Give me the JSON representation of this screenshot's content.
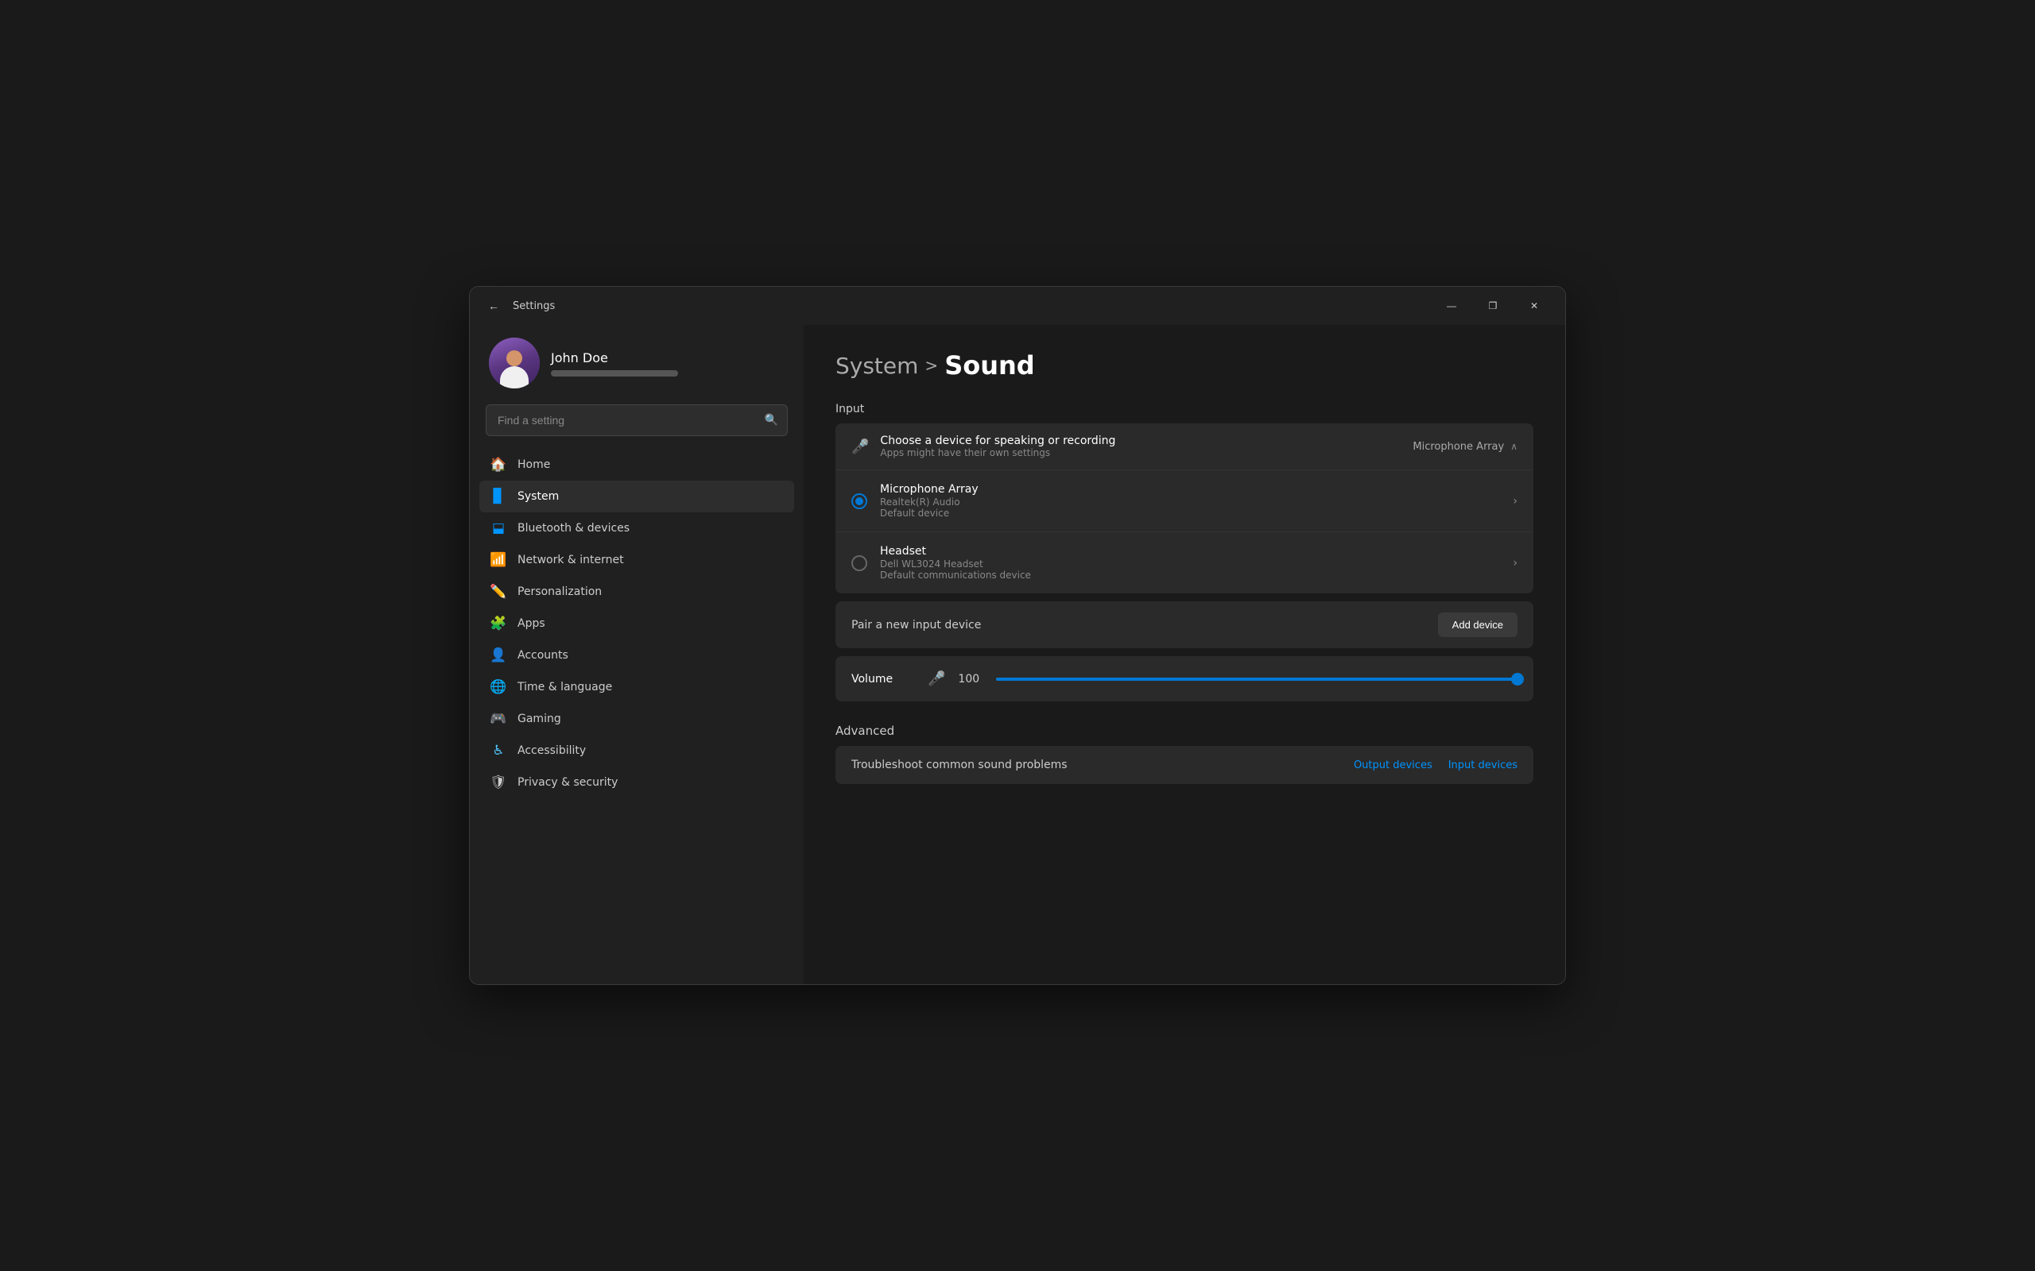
{
  "window": {
    "title": "Settings",
    "controls": {
      "minimize": "—",
      "restore": "❐",
      "close": "✕"
    }
  },
  "sidebar": {
    "user": {
      "name": "John Doe"
    },
    "search_placeholder": "Find a setting",
    "nav_items": [
      {
        "id": "home",
        "label": "Home",
        "icon": "🏠"
      },
      {
        "id": "system",
        "label": "System",
        "icon": "🖥",
        "active": true
      },
      {
        "id": "bluetooth",
        "label": "Bluetooth & devices",
        "icon": "🔵"
      },
      {
        "id": "network",
        "label": "Network & internet",
        "icon": "📶"
      },
      {
        "id": "personalization",
        "label": "Personalization",
        "icon": "✏️"
      },
      {
        "id": "apps",
        "label": "Apps",
        "icon": "🧩"
      },
      {
        "id": "accounts",
        "label": "Accounts",
        "icon": "👤"
      },
      {
        "id": "time",
        "label": "Time & language",
        "icon": "🌐"
      },
      {
        "id": "gaming",
        "label": "Gaming",
        "icon": "🎮"
      },
      {
        "id": "accessibility",
        "label": "Accessibility",
        "icon": "♿"
      },
      {
        "id": "privacy",
        "label": "Privacy & security",
        "icon": "🛡"
      }
    ]
  },
  "main": {
    "breadcrumb": {
      "parent": "System",
      "separator": ">",
      "current": "Sound"
    },
    "input_section": {
      "label": "Input",
      "header": {
        "title": "Choose a device for speaking or recording",
        "subtitle": "Apps might have their own settings",
        "selected_device": "Microphone Array"
      },
      "devices": [
        {
          "name": "Microphone Array",
          "subtitle": "Realtek(R) Audio",
          "default_label": "Default device",
          "selected": true
        },
        {
          "name": "Headset",
          "subtitle": "Dell WL3024 Headset",
          "default_label": "Default communications device",
          "selected": false
        }
      ],
      "pair_label": "Pair a new input device",
      "add_button": "Add device"
    },
    "volume": {
      "label": "Volume",
      "value": "100"
    },
    "advanced_section": {
      "label": "Advanced",
      "troubleshoot": {
        "label": "Troubleshoot common sound problems",
        "link1": "Output devices",
        "link2": "Input devices"
      }
    }
  }
}
